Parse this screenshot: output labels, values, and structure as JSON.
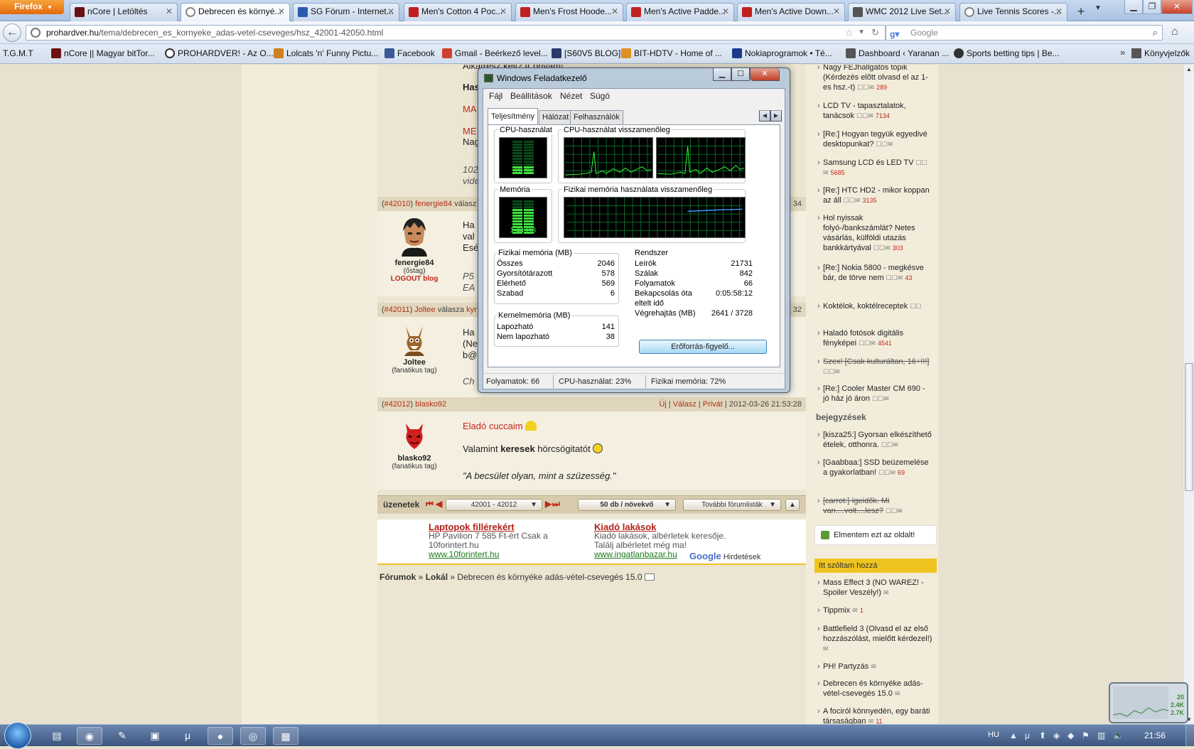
{
  "browser": {
    "menu_button": "Firefox",
    "tabs": [
      {
        "title": "nCore | Letöltés",
        "color": "#6b1010"
      },
      {
        "title": "Debrecen és környé...",
        "color": "#888888",
        "active": true
      },
      {
        "title": "SG Fórum - Internet...",
        "color": "#2a5ab0"
      },
      {
        "title": "Men's Cotton 4 Poc...",
        "color": "#c02020"
      },
      {
        "title": "Men's Frost Hoode...",
        "color": "#c02020"
      },
      {
        "title": "Men's Active Padde...",
        "color": "#c02020"
      },
      {
        "title": "Men's Active Down...",
        "color": "#c02020"
      },
      {
        "title": "WMC 2012 Live Set...",
        "color": "#555555"
      },
      {
        "title": "Live Tennis Scores -...",
        "color": "#888888"
      }
    ],
    "url_host": "prohardver.hu",
    "url_path": "/tema/debrecen_es_kornyeke_adas-vetel-cseveges/hsz_42001-42050.html",
    "search_placeholder": "Google",
    "bookmarks": [
      {
        "label": "T.G.M.T",
        "color": ""
      },
      {
        "label": "nCore || Magyar bitTor...",
        "color": "#6b1010"
      },
      {
        "label": "PROHARDVER! - Az O...",
        "color": "#333333"
      },
      {
        "label": "Lolcats 'n' Funny Pictu...",
        "color": "#d08020"
      },
      {
        "label": "Facebook",
        "color": "#3b5998"
      },
      {
        "label": "Gmail - Beérkező level...",
        "color": "#d04030"
      },
      {
        "label": "[S60V5 BLOG]",
        "color": "#2a3a6a"
      },
      {
        "label": "BIT-HDTV - Home of ...",
        "color": "#e09020"
      },
      {
        "label": "Nokiaprogramok • Té...",
        "color": "#1a3a8a"
      },
      {
        "label": "Dashboard ‹ Yaranan ...",
        "color": "#555555"
      },
      {
        "label": "Sports betting tips | Be...",
        "color": "#333333"
      }
    ],
    "bookmarks_menu": "Könyvjelzők"
  },
  "forum": {
    "posts": [
      {
        "header_num": "#42010",
        "header_user": "fenergie84",
        "header_rest": "válasz",
        "header_right": "34",
        "name": "fenergie84",
        "rank": "(őstag)",
        "blog": "LOGOUT blog",
        "lines": [
          "Ha",
          "val",
          "Esé",
          "P5",
          "EA"
        ]
      },
      {
        "header_num": "#42011",
        "header_user": "Joltee",
        "header_rest": "válasza",
        "header_reply_to": "kyr",
        "header_right": "32",
        "name": "Joltee",
        "rank": "(fanatikus tag)",
        "lines": [
          "Ha",
          "(Ne",
          "b@",
          "Ch"
        ]
      },
      {
        "header_num": "#42012",
        "header_user": "blasko92",
        "actions": [
          "Új",
          "Válasz",
          "Privát"
        ],
        "datetime": "2012-03-26 21:53:28",
        "name": "blasko92",
        "rank": "(fanatikus tag)",
        "title": "Eladó cuccaim",
        "line_pre": "Valamint ",
        "line_bold": "keresek",
        "line_post": " hörcsögitatót",
        "quote": "\"A becsület olyan, mint a szüzesség.\""
      }
    ],
    "top_partial": [
      "Alkatrész kell? Ir privam!",
      "Has",
      "MA",
      "ME",
      "Nag",
      "102",
      "vide"
    ],
    "pager": {
      "label": "üzenetek",
      "range": "42001 - 42012",
      "per_page": "50 db / növekvő",
      "more": "További fórumlisták"
    },
    "ads": [
      {
        "title": "Laptopok fillérekért",
        "line1": "HP Pavilion 7 585 Ft-ért Csak a",
        "line2": "10forintert.hu",
        "url": "www.10forintert.hu"
      },
      {
        "title": "Kiadó lakások",
        "line1": "Kiadó lakások, albérletek keresője.",
        "line2": "Találj albérletet még ma!",
        "url": "www.ingatlanbazar.hu"
      }
    ],
    "google_ads": "Hirdetések",
    "google_word": "Google",
    "breadcrumb": [
      "Fórumok",
      "Lokál",
      "Debrecen és környéke adás-vétel-csevegés 15.0"
    ]
  },
  "sidebar": {
    "items": [
      {
        "text": "Nagy FEJhallgatós topik (Kérdezés előtt olvasd el az 1-es hsz.-t)",
        "count": "289"
      },
      {
        "text": "LCD TV - tapasztalatok, tanácsok",
        "count": "7134"
      },
      {
        "text": "[Re:] Hogyan tegyük egyedivé desktopunkat?",
        "count": ""
      },
      {
        "text": "Samsung LCD és LED TV",
        "count": "5685"
      },
      {
        "text": "[Re:] HTC HD2 - mikor koppan az áll",
        "count": "3135"
      },
      {
        "text": "Hol nyissak folyó-/bankszámlát? Netes vásárlás, külföldi utazás bankkártyával",
        "count": "303"
      },
      {
        "text": "[Re:] Nokia 5800 - megkésve bár, de törve nem",
        "count": "43"
      },
      {
        "text": "Koktélok, koktélreceptek",
        "count": ""
      },
      {
        "text": "Haladó fotósok digitális fényképei",
        "count": "4541"
      },
      {
        "text": "Szex! [Csak kulturáltan, 16+!!!]",
        "count": "",
        "strike": true
      },
      {
        "text": "[Re:] Cooler Master CM 690 - jó ház jó áron",
        "count": ""
      }
    ],
    "bejegyzesek_label": "bejegyzések",
    "bejegyzesek": [
      {
        "text": "[kisza25:] Gyorsan elkészíthető ételek, otthonra.",
        "count": ""
      },
      {
        "text": "[Gaabbaa:] SSD beüzemelése a gyakorlatban!",
        "count": "69"
      },
      {
        "text": "[carrot:] Igeidők. Mi van....volt....lesz?",
        "count": "",
        "strike": true
      }
    ],
    "save_label": "Elmentem ezt az oldalt!",
    "itt_label": "Itt szóltam hozzá",
    "itt_items": [
      {
        "text": "Mass Effect 3 (NO WAREZ! - Spoiler Veszély!)",
        "count": ""
      },
      {
        "text": "Tippmix",
        "count": "1"
      },
      {
        "text": "Battlefield 3 (Olvasd el az első hozzászólást, mielőtt kérdezel!)",
        "count": ""
      },
      {
        "text": "PH! Partyzás",
        "count": ""
      },
      {
        "text": "Debrecen és környéke adás-vétel-csevegés 15.0",
        "count": ""
      },
      {
        "text": "A fociról könnyedén, egy baráti társaságban",
        "count": "11"
      }
    ]
  },
  "taskmanager": {
    "title": "Windows Feladatkezelő",
    "menu": [
      "Fájl",
      "Beállítások",
      "Nézet",
      "Súgó"
    ],
    "tabs": [
      "Teljesítmény",
      "Hálózat",
      "Felhasználók"
    ],
    "cpu_label": "CPU-használat",
    "cpu_value": "23 %",
    "cpu_fraction": 0.23,
    "cpu_hist_label": "CPU-használat visszamenőleg",
    "mem_label": "Memória",
    "mem_value": "1,44 GB",
    "mem_fraction": 0.72,
    "mem_hist_label": "Fizikai memória használata visszamenőleg",
    "phys_title": "Fizikai memória (MB)",
    "phys": [
      {
        "k": "Összes",
        "v": "2046"
      },
      {
        "k": "Gyorsítótárazott",
        "v": "578"
      },
      {
        "k": "Elérhető",
        "v": "569"
      },
      {
        "k": "Szabad",
        "v": "6"
      }
    ],
    "kernel_title": "Kernelmemória (MB)",
    "kernel": [
      {
        "k": "Lapozható",
        "v": "141"
      },
      {
        "k": "Nem lapozható",
        "v": "38"
      }
    ],
    "sys_title": "Rendszer",
    "sys": [
      {
        "k": "Leírók",
        "v": "21731"
      },
      {
        "k": "Szálak",
        "v": "842"
      },
      {
        "k": "Folyamatok",
        "v": "66"
      },
      {
        "k": "Bekapcsolás óta",
        "v": "0:05:58:12"
      },
      {
        "k": "eltelt idő",
        "v": ""
      },
      {
        "k": "Végrehajtás (MB)",
        "v": "2641 / 3728"
      }
    ],
    "resource_button": "Erőforrás-figyelő...",
    "status_processes": "Folyamatok: 66",
    "status_cpu": "CPU-használat: 23%",
    "status_mem": "Fizikai memória: 72%"
  },
  "taskbar": {
    "language": "HU",
    "clock": "21:56"
  },
  "gadget": {
    "values": [
      "20",
      "2.4K",
      "2.7K"
    ]
  }
}
